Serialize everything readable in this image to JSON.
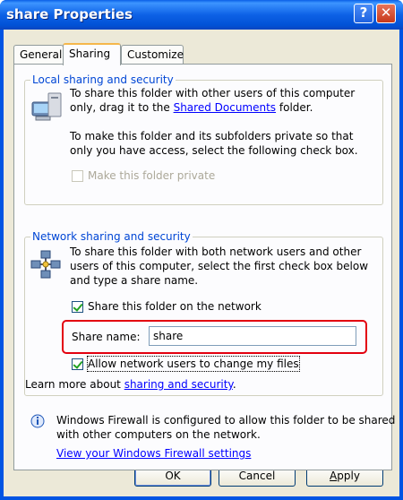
{
  "window": {
    "title": "share Properties",
    "help_button": "?",
    "close_button": "✕"
  },
  "tabs": [
    {
      "label": "General",
      "active": false
    },
    {
      "label": "Sharing",
      "active": true
    },
    {
      "label": "Customize",
      "active": false
    }
  ],
  "local": {
    "group_title": "Local sharing and security",
    "desc_line1": "To share this folder with other users of this computer",
    "desc_line2_pre": "only, drag it to the ",
    "desc_link": "Shared Documents",
    "desc_line2_post": " folder.",
    "private_line1": "To make this folder and its subfolders private so that",
    "private_line2": "only you have access, select the following check box.",
    "private_checkbox": {
      "label": "Make this folder private",
      "checked": false,
      "enabled": false
    }
  },
  "network": {
    "group_title": "Network sharing and security",
    "desc_line1": "To share this folder with both network users and other",
    "desc_line2": "users of this computer, select the first check box below",
    "desc_line3": "and type a share name.",
    "share_checkbox": {
      "label": "Share this folder on the network",
      "checked": true
    },
    "share_name_label": "Share name:",
    "share_name_value": "share",
    "allow_change_checkbox": {
      "label": "Allow network users to change my files",
      "checked": true
    },
    "learn_more_pre": "Learn more about ",
    "learn_more_link": "sharing and security",
    "learn_more_post": "."
  },
  "firewall": {
    "line1": "Windows Firewall is configured to allow this folder to be shared",
    "line2": "with other computers on the network.",
    "link": "View your Windows Firewall settings"
  },
  "buttons": {
    "ok": "OK",
    "cancel": "Cancel",
    "apply": "Apply"
  },
  "colors": {
    "titlebar": "#0054e3",
    "group_title": "#0046d5",
    "link": "#0000ff",
    "highlight": "#e3000f"
  }
}
